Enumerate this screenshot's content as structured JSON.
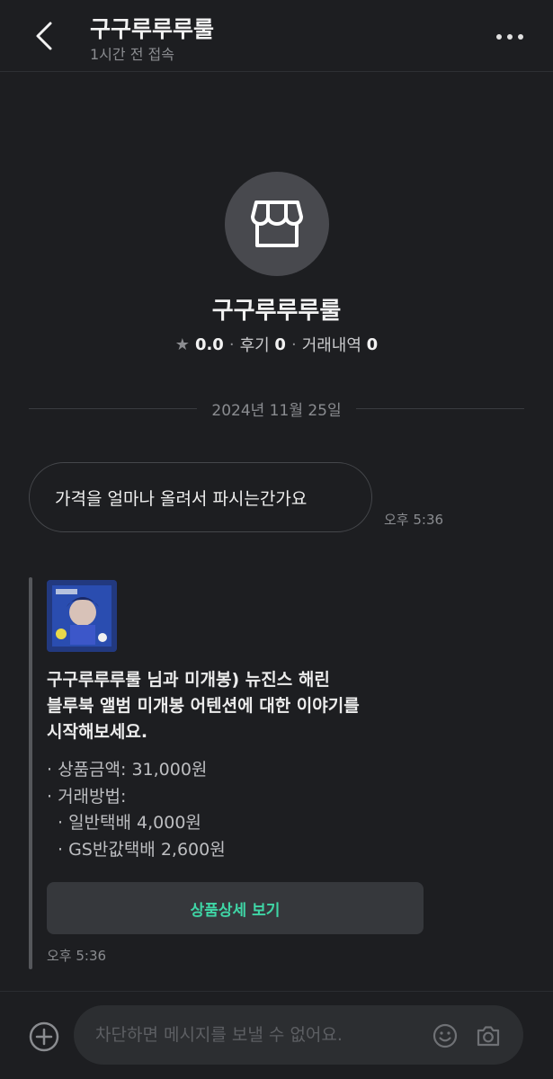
{
  "header": {
    "title": "구구루루루룰",
    "last_seen": "1시간 전 접속",
    "back_icon": "chevron-left-icon",
    "more_icon": "more-horizontal-icon"
  },
  "profile": {
    "avatar_icon": "store-icon",
    "name": "구구루루루룰",
    "rating": "0.0",
    "reviews_label": "후기",
    "reviews_count": "0",
    "trades_label": "거래내역",
    "trades_count": "0"
  },
  "chat": {
    "date": "2024년 11월 25일",
    "messages": [
      {
        "text": "가격을 얼마나 올려서 파시는간가요",
        "time": "오후 5:36"
      }
    ]
  },
  "product_card": {
    "title_lines": [
      "구구루루루룰 님과 미개봉) 뉴진스 해린",
      "블루북 앨범 미개봉 어텐션에 대한 이야기를",
      "시작해보세요."
    ],
    "details": [
      "· 상품금액: 31,000원",
      "· 거래방법:",
      "· 일반택배 4,000원",
      "· GS반값택배 2,600원"
    ],
    "button_label": "상품상세 보기",
    "time": "오후 5:36"
  },
  "footer": {
    "placeholder": "차단하면 메시지를 보낼 수 없어요.",
    "icons": [
      "plus-circle-icon",
      "smile-icon",
      "camera-icon"
    ]
  },
  "colors": {
    "background": "#1d1e21",
    "accent": "#3fd6a6",
    "bubble_border": "#45474b"
  }
}
